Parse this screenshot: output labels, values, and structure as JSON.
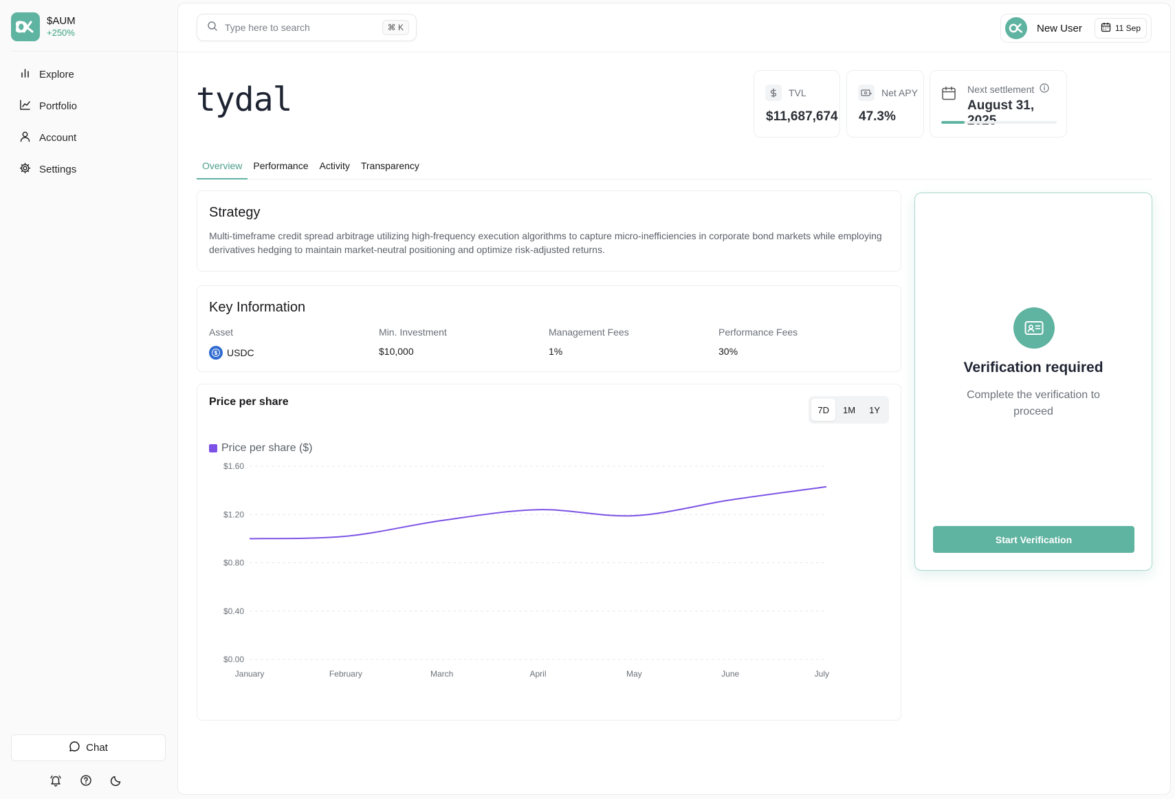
{
  "brand": {
    "name": "$AUM",
    "change": "+250%"
  },
  "nav": [
    {
      "label": "Explore",
      "icon": "bar-chart-icon"
    },
    {
      "label": "Portfolio",
      "icon": "line-chart-icon"
    },
    {
      "label": "Account",
      "icon": "user-icon"
    },
    {
      "label": "Settings",
      "icon": "gear-icon"
    }
  ],
  "sidebar_footer": {
    "chat_label": "Chat"
  },
  "search": {
    "placeholder": "Type here to search",
    "shortcut": "⌘ K"
  },
  "user": {
    "name": "New User",
    "date": "11 Sep"
  },
  "vault": {
    "logo_text": "tydal"
  },
  "stats": {
    "tvl": {
      "label": "TVL",
      "value": "$11,687,674"
    },
    "apy": {
      "label": "Net APY",
      "value": "47.3%"
    },
    "settlement": {
      "label": "Next settlement",
      "value": "August 31, 2025",
      "progress": 0.2
    }
  },
  "tabs": [
    "Overview",
    "Performance",
    "Activity",
    "Transparency"
  ],
  "strategy": {
    "title": "Strategy",
    "text": "Multi-timeframe credit spread arbitrage utilizing high-frequency execution algorithms to capture micro-inefficiencies in corporate bond markets while employing derivatives hedging to maintain market-neutral positioning and optimize risk-adjusted returns."
  },
  "key_info": {
    "title": "Key Information",
    "items": [
      {
        "label": "Asset",
        "value": "USDC"
      },
      {
        "label": "Min. Investment",
        "value": "$10,000"
      },
      {
        "label": "Management Fees",
        "value": "1%"
      },
      {
        "label": "Performance Fees",
        "value": "30%"
      }
    ]
  },
  "price_card": {
    "title": "Price per share",
    "ranges": [
      "7D",
      "1M",
      "1Y"
    ],
    "active_range": "7D"
  },
  "chart_data": {
    "type": "line",
    "title": "Price per share",
    "legend": "Price per share ($)",
    "categories": [
      "January",
      "February",
      "March",
      "April",
      "May",
      "June",
      "July"
    ],
    "series": [
      {
        "name": "Price per share ($)",
        "values": [
          1.0,
          1.02,
          1.15,
          1.24,
          1.19,
          1.32,
          1.43
        ]
      }
    ],
    "ylim": [
      0,
      1.6
    ],
    "yticks": [
      "$0.00",
      "$0.40",
      "$0.80",
      "$1.20",
      "$1.60"
    ],
    "ytick_values": [
      0,
      0.4,
      0.8,
      1.2,
      1.6
    ],
    "grid": true,
    "color": "#7c52e6"
  },
  "verification": {
    "title": "Verification required",
    "subtitle": "Complete the verification to proceed",
    "button": "Start Verification"
  },
  "colors": {
    "accent": "#5fb3a1",
    "line": "#7c52e6"
  }
}
